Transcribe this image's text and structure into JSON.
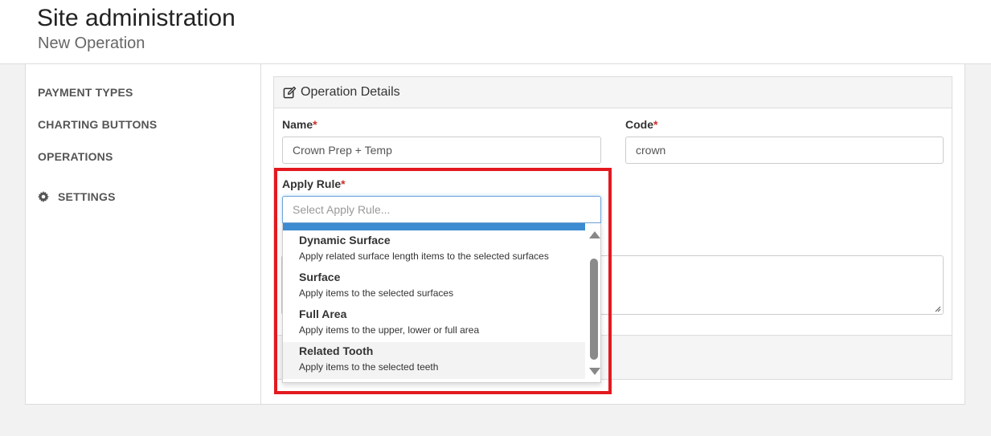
{
  "header": {
    "title": "Site administration",
    "subtitle": "New Operation"
  },
  "sidebar": {
    "items": [
      {
        "label": "PAYMENT TYPES"
      },
      {
        "label": "CHARTING BUTTONS"
      },
      {
        "label": "OPERATIONS"
      },
      {
        "label": "SETTINGS",
        "icon": "gear-icon"
      }
    ]
  },
  "card": {
    "title": "Operation Details",
    "title_icon": "edit-icon"
  },
  "form": {
    "name": {
      "label": "Name",
      "required_mark": "*",
      "value": "Crown Prep + Temp"
    },
    "code": {
      "label": "Code",
      "required_mark": "*",
      "value": "crown"
    },
    "apply_rule": {
      "label": "Apply Rule",
      "required_mark": "*",
      "placeholder": "Select Apply Rule...",
      "options": [
        {
          "title": "Dynamic Surface",
          "description": "Apply related surface length items to the selected surfaces"
        },
        {
          "title": "Surface",
          "description": "Apply items to the selected surfaces"
        },
        {
          "title": "Full Area",
          "description": "Apply items to the upper, lower or full area"
        },
        {
          "title": "Related Tooth",
          "description": "Apply items to the selected teeth"
        }
      ]
    }
  },
  "colors": {
    "highlight_box": "#e3191f",
    "selected_option": "#3d8bd0",
    "required": "#c9302c",
    "primary_button": "#2d5a9a"
  }
}
